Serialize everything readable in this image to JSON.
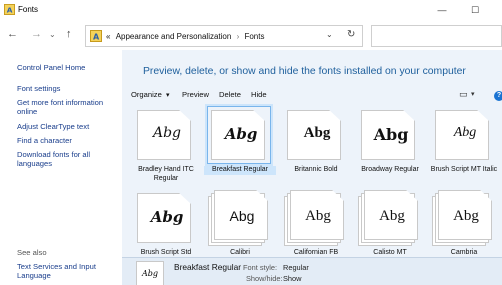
{
  "window": {
    "title": "Fonts",
    "minimize_glyph": "—",
    "maximize_glyph": "☐"
  },
  "nav": {
    "back_icon": "←",
    "forward_icon": "→",
    "dropdown_icon": "⌄",
    "up_icon": "↑",
    "crumb_overflow": "«",
    "crumbs": [
      "Appearance and Personalization",
      "Fonts"
    ],
    "crumb_sep": "›",
    "address_dropdown": "⌄",
    "refresh_icon": "↻",
    "search_placeholder": ""
  },
  "sidebar": {
    "home": "Control Panel Home",
    "links": [
      "Font settings",
      "Get more font information online",
      "Adjust ClearType text",
      "Find a character",
      "Download fonts for all languages"
    ],
    "see_also": "See also",
    "see_also_links": [
      "Text Services and Input Language"
    ]
  },
  "main": {
    "headline": "Preview, delete, or show and hide the fonts installed on your computer",
    "toolbar": {
      "organize": "Organize",
      "organize_caret": "▾",
      "preview": "Preview",
      "delete": "Delete",
      "hide": "Hide",
      "view_icon": "▭",
      "view_caret": "▾",
      "help": "?"
    },
    "fonts": [
      {
        "label": "Bradley Hand ITC Regular",
        "sample": "Abg",
        "style": "script",
        "stacked": false,
        "selected": false
      },
      {
        "label": "Breakfast Regular",
        "sample": "Abg",
        "style": "scriptbold",
        "stacked": false,
        "selected": true
      },
      {
        "label": "Britannic Bold",
        "sample": "Abg",
        "style": "bold",
        "stacked": false,
        "selected": false
      },
      {
        "label": "Broadway Regular",
        "sample": "Abg",
        "style": "heavy",
        "stacked": false,
        "selected": false
      },
      {
        "label": "Brush Script MT Italic",
        "sample": "Abg",
        "style": "italic",
        "stacked": false,
        "selected": false
      },
      {
        "label": "Brush Script Std",
        "sample": "Abg",
        "style": "scriptbold",
        "stacked": false,
        "selected": false
      },
      {
        "label": "Calibri",
        "sample": "Abg",
        "style": "plain",
        "stacked": true,
        "selected": false
      },
      {
        "label": "Californian FB",
        "sample": "Abg",
        "style": "serif",
        "stacked": true,
        "selected": false
      },
      {
        "label": "Calisto MT",
        "sample": "Abg",
        "style": "serif",
        "stacked": true,
        "selected": false
      },
      {
        "label": "Cambria",
        "sample": "Abg",
        "style": "serif",
        "stacked": true,
        "selected": false
      }
    ]
  },
  "details": {
    "thumb_sample": "Abg",
    "name": "Breakfast Regular",
    "style_key": "Font style:",
    "style_value": "Regular",
    "showhide_key": "Show/hide:",
    "showhide_value": "Show"
  },
  "colors": {
    "accent": "#1e5f9c",
    "link": "#1a3e8c",
    "main_bg": "#edf3fa",
    "selection": "#cde5fb"
  }
}
